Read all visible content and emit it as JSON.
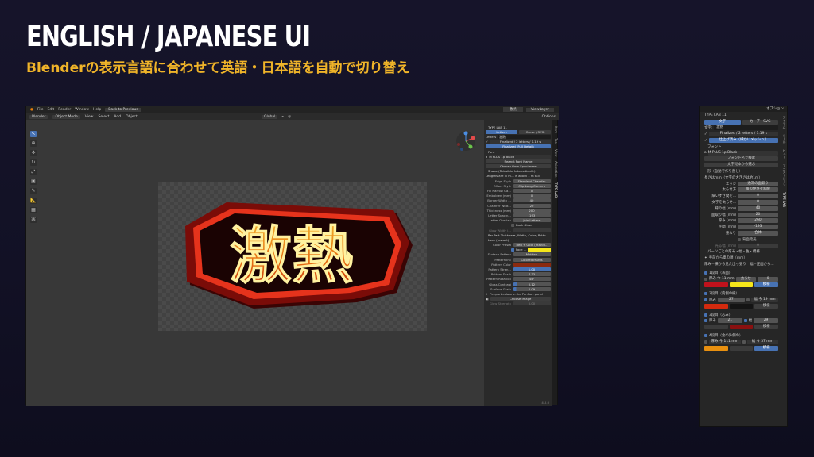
{
  "heading": {
    "title": "ENGLISH / JAPANESE UI",
    "subtitle": "Blenderの表示言語に合わせて英語・日本語を自動で切り替え"
  },
  "blender": {
    "menubar": [
      "File",
      "Edit",
      "Render",
      "Window",
      "Help"
    ],
    "back_button": "Back to Previous",
    "scene_label": "激熱",
    "viewlayer_label": "ViewLayer",
    "header": {
      "editor": "Blender",
      "mode": "Object Mode",
      "menus": [
        "View",
        "Select",
        "Add",
        "Object"
      ],
      "transform": "Global",
      "options": "Options"
    },
    "side_tabs": [
      "Item",
      "Tool",
      "View",
      "Animation",
      "TYPE LAB"
    ],
    "panel": {
      "title": "TYPE LAB 11",
      "tab_letters": "Letters",
      "tab_curve": "Curve / SVG",
      "letters_label": "Letters",
      "letters_value": "激熱",
      "finalized_1": "Finalized / 2 letters / 1.19 s",
      "finalized_2": "Finalized (Full Detail)",
      "font_section": "Font",
      "font_name": "M PLUS 1p Black",
      "search_font": "Search Font Name",
      "choose_specimen": "Choose from Specimens",
      "shape_section": "Shape (Rebuilds Automatically)",
      "note": "Lengths are in m... is about 1 m tall",
      "fields": [
        {
          "label": "Edge Style",
          "value": "Standard Chamfer"
        },
        {
          "label": "Offset Style",
          "value": "Clip Long Corners"
        },
        {
          "label": "Fill Narrow Ga...",
          "value": "0"
        },
        {
          "label": "Embolden (mm)",
          "value": "0"
        },
        {
          "label": "Border Width ...",
          "value": "40"
        },
        {
          "label": "Chamfer Widt...",
          "value": "20"
        },
        {
          "label": "Thickness (mm)",
          "value": "200"
        },
        {
          "label": "Letter Spacin...",
          "value": "-193"
        },
        {
          "label": "Letter Overlap",
          "value": "Join Letters"
        }
      ],
      "back_glow": "Back Glow",
      "glow_width": "Glow Width (...",
      "per_part": "Per-Part Thickness, Width, Color, Patte",
      "look_section": "Look (Instant)",
      "color_preset_label": "Color Preset",
      "color_preset": "Red + Gold (Stand...",
      "face_label": "Face ...",
      "look_fields": [
        {
          "label": "Surface Pattern",
          "value": "Mottled"
        },
        {
          "label": "Pattern Ink",
          "value": "Colored Marks"
        },
        {
          "label": "Pattern Color",
          "value": ""
        },
        {
          "label": "Pattern Stren...",
          "value": "1.00"
        },
        {
          "label": "Pattern Scale",
          "value": "7.33"
        },
        {
          "label": "Pattern Rotation",
          "value": "45°"
        },
        {
          "label": "Gloss Contrast",
          "value": "0.12"
        },
        {
          "label": "Surface Grain",
          "value": "0.09"
        }
      ],
      "per_part_colors": "Per-part colors a...he Per-Part panel",
      "choose_image": "Choose Image",
      "glow_strength": "Glow Strength",
      "glow_strength_value": "0.00",
      "version": "4.2.0"
    }
  },
  "artwork_text": "激熱",
  "jp_panel": {
    "options": "オプション",
    "title": "TYPE LAB 11",
    "tab_letters": "文字",
    "tab_curve": "カーブ・SVG",
    "letters_label": "文字:",
    "letters_value": "激熱",
    "finalized_1": "Finalized / 2 letters / 1.19 s",
    "finalized_2": "仕上げ済み（細かいメッシュ）",
    "font_section": "フォント",
    "font_name": "M PLUS 1p Black",
    "search_font": "フォント名で検索",
    "choose_specimen": "文字見本から選ぶ",
    "shape_section": "形（自動で作り直し）",
    "note": "長さはmm（文字の大きさは約1m）",
    "fields": [
      {
        "label": "エッジ",
        "value": "通常の面取り"
      },
      {
        "label": "太らせ方",
        "value": "角の伸びを制限"
      },
      {
        "label": "細いすき間を...",
        "value": "0"
      },
      {
        "label": "文字を太らせ...",
        "value": "0"
      },
      {
        "label": "縁の幅 (mm)",
        "value": "40"
      },
      {
        "label": "面取り幅 (mm)",
        "value": "20"
      },
      {
        "label": "厚み (mm)",
        "value": "260"
      },
      {
        "label": "字間 (mm)",
        "value": "-193"
      },
      {
        "label": "重なり",
        "value": "合体"
      }
    ],
    "back_glow": "背面発光",
    "glow_width": "光る幅 (mm)",
    "glow_width_value": "0",
    "parts_section": "パーツごとの厚み・幅・色・模様",
    "parts_note1": "手前から奥の順（mm）",
    "parts_note2": "厚み＝横から見た出っ張り　幅＝正面から...",
    "layers": [
      {
        "name": "1段目（表面）",
        "thick_label": "厚み 今 11 mm",
        "width_label": "太らせ",
        "width_value": "0",
        "c1": "#c0121c",
        "c2": "#f5e61a",
        "btn": "模様"
      },
      {
        "name": "2段目（内側の縁）",
        "thick_label": "厚み",
        "thick_value": "27",
        "width_label": "幅 今 19 mm",
        "c1": "#d32a0e",
        "c2": "#141414",
        "btn": "模様"
      },
      {
        "name": "3段目（芯み）",
        "thick_label": "厚み",
        "thick_value": "21",
        "width_label": "幅",
        "width_value": "29",
        "c1": "#3b3b3b",
        "c2": "#8a1010",
        "btn": "模様"
      },
      {
        "name": "4段目（金の外側の）",
        "thick_label": "厚み 今 111 mm",
        "width_label": "幅 今 37 mm",
        "c1": "#e89010",
        "c2": "#3b3b3b",
        "btn": "模様"
      }
    ],
    "side_tabs": [
      "アイテム",
      "ツール",
      "ビュー",
      "アニメーション",
      "TYPE LAB"
    ]
  },
  "colors": {
    "accent": "#f0b429",
    "blue": "#4772b3"
  }
}
